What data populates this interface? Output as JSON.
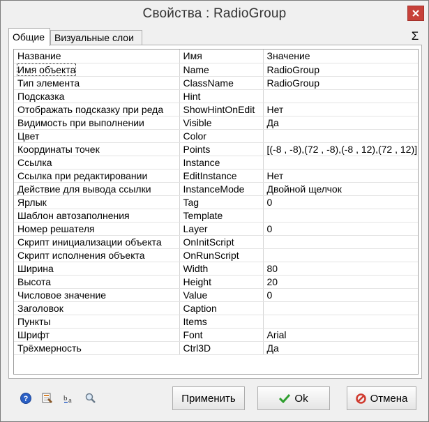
{
  "window": {
    "title": "Свойства :   RadioGroup"
  },
  "tabs": [
    {
      "label": "Общие",
      "active": true
    },
    {
      "label": "Визуальные слои",
      "active": false
    }
  ],
  "sigma_label": "Σ",
  "table": {
    "headers": [
      "Название",
      "Имя",
      "Значение"
    ],
    "rows": [
      [
        "Имя объекта",
        "Name",
        "RadioGroup"
      ],
      [
        "Тип элемента",
        "ClassName",
        "RadioGroup"
      ],
      [
        "Подсказка",
        "Hint",
        ""
      ],
      [
        "Отображать подсказку при реда",
        "ShowHintOnEdit",
        "Нет"
      ],
      [
        "Видимость при выполнении",
        "Visible",
        "Да"
      ],
      [
        "Цвет",
        "Color",
        ""
      ],
      [
        "Координаты точек",
        "Points",
        "[(-8 , -8),(72 , -8),(-8 , 12),(72 , 12)]"
      ],
      [
        "Ссылка",
        "Instance",
        ""
      ],
      [
        "Ссылка при редактировании",
        "EditInstance",
        "Нет"
      ],
      [
        "Действие для вывода ссылки",
        "InstanceMode",
        "Двойной щелчок"
      ],
      [
        "Ярлык",
        "Tag",
        "0"
      ],
      [
        "Шаблон автозаполнения",
        "Template",
        ""
      ],
      [
        "Номер решателя",
        "Layer",
        "0"
      ],
      [
        "Скрипт инициализации объекта",
        "OnInitScript",
        ""
      ],
      [
        "Скрипт исполнения объекта",
        "OnRunScript",
        ""
      ],
      [
        "Ширина",
        "Width",
        "80"
      ],
      [
        "Высота",
        "Height",
        "20"
      ],
      [
        "Числовое значение",
        "Value",
        "0"
      ],
      [
        "Заголовок",
        "Caption",
        ""
      ],
      [
        "Пункты",
        "Items",
        ""
      ],
      [
        "Шрифт",
        "Font",
        "Arial"
      ],
      [
        "Трёхмерность",
        "Ctrl3D",
        "Да"
      ]
    ]
  },
  "buttons": {
    "apply": "Применить",
    "ok": "Ok",
    "cancel": "Отмена"
  },
  "colors": {
    "close_button": "#c7413a",
    "ok_check": "#2e9e2e",
    "cancel_icon": "#d03a2f",
    "help_icon": "#2a5fc4"
  }
}
